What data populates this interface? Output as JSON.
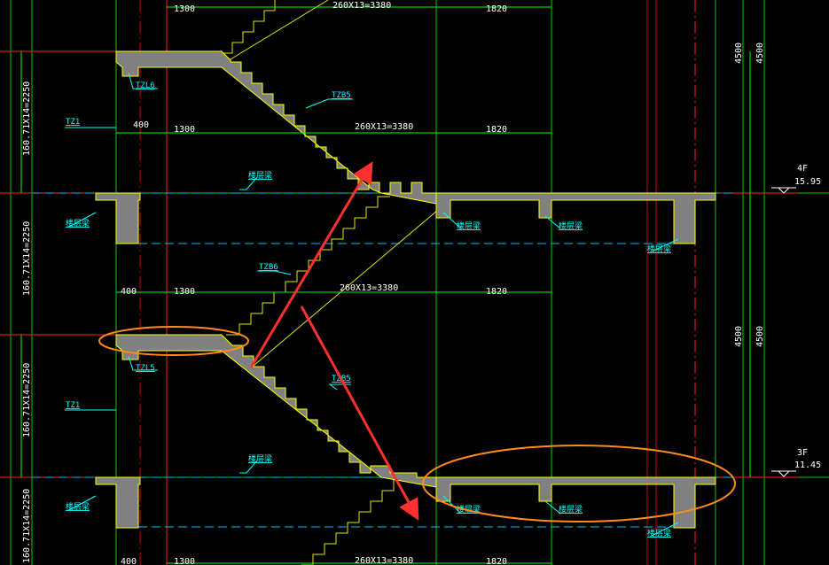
{
  "dims": {
    "flight": "260X13=3380",
    "landing": "1820",
    "width_1300": "1300",
    "width_400": "400",
    "floor_height": "4500",
    "stair_height": "160.71X14=2250"
  },
  "labels": {
    "tzl6": "TZL6",
    "tzl5": "TZL5",
    "tzb5": "TZB5",
    "tzb6": "TZB6",
    "tz1": "TZ1",
    "floor_beam": "楼层梁",
    "floor_beam_left": "楼层梁"
  },
  "levels": {
    "f4_name": "4F",
    "f4_elev": "15.95",
    "f3_name": "3F",
    "f3_elev": "11.45"
  },
  "colors": {
    "background": "#000000",
    "structure_fill": "#808080",
    "structure_edge": "#ffff00",
    "dimension_green": "#00ff00",
    "axis_red": "#ff0000",
    "annotation_cyan": "#00ffff",
    "arrow_red": "#ff3030",
    "highlight_orange": "#ff8c1a"
  }
}
